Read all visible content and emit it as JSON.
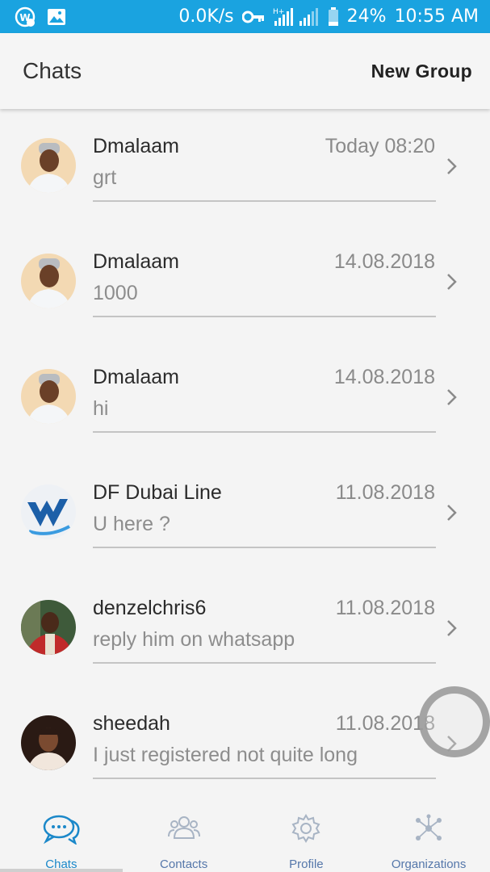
{
  "status_bar": {
    "speed": "0.0K/s",
    "network": "H+",
    "battery": "24%",
    "time": "10:55 AM",
    "icons": [
      "app-badge-icon",
      "gallery-icon",
      "vpn-key-icon",
      "signal-icon",
      "battery-icon"
    ]
  },
  "header": {
    "title": "Chats",
    "new_group": "New Group"
  },
  "chats": [
    {
      "name": "Dmalaam",
      "date": "Today 08:20",
      "message": "grt",
      "avatar": "person-cap-avatar"
    },
    {
      "name": "Dmalaam",
      "date": "14.08.2018",
      "message": "1000",
      "avatar": "person-cap-avatar"
    },
    {
      "name": "Dmalaam",
      "date": "14.08.2018",
      "message": "hi",
      "avatar": "person-cap-avatar"
    },
    {
      "name": "DF Dubai Line",
      "date": "11.08.2018",
      "message": "U here ?",
      "avatar": "logo-avatar"
    },
    {
      "name": "denzelchris6",
      "date": "11.08.2018",
      "message": "reply him on whatsapp",
      "avatar": "person-avatar"
    },
    {
      "name": "sheedah",
      "date": "11.08.2018",
      "message": "I just registered not quite long",
      "avatar": "person-avatar"
    }
  ],
  "bottom_nav": [
    {
      "label": "Chats",
      "icon": "chat-bubbles-icon",
      "active": true
    },
    {
      "label": "Contacts",
      "icon": "contacts-icon",
      "active": false
    },
    {
      "label": "Profile",
      "icon": "gear-icon",
      "active": false
    },
    {
      "label": "Organizations",
      "icon": "network-icon",
      "active": false
    }
  ],
  "colors": {
    "status_bar": "#1aa3e0",
    "accent": "#1b88c9",
    "background": "#f4f4f4"
  }
}
